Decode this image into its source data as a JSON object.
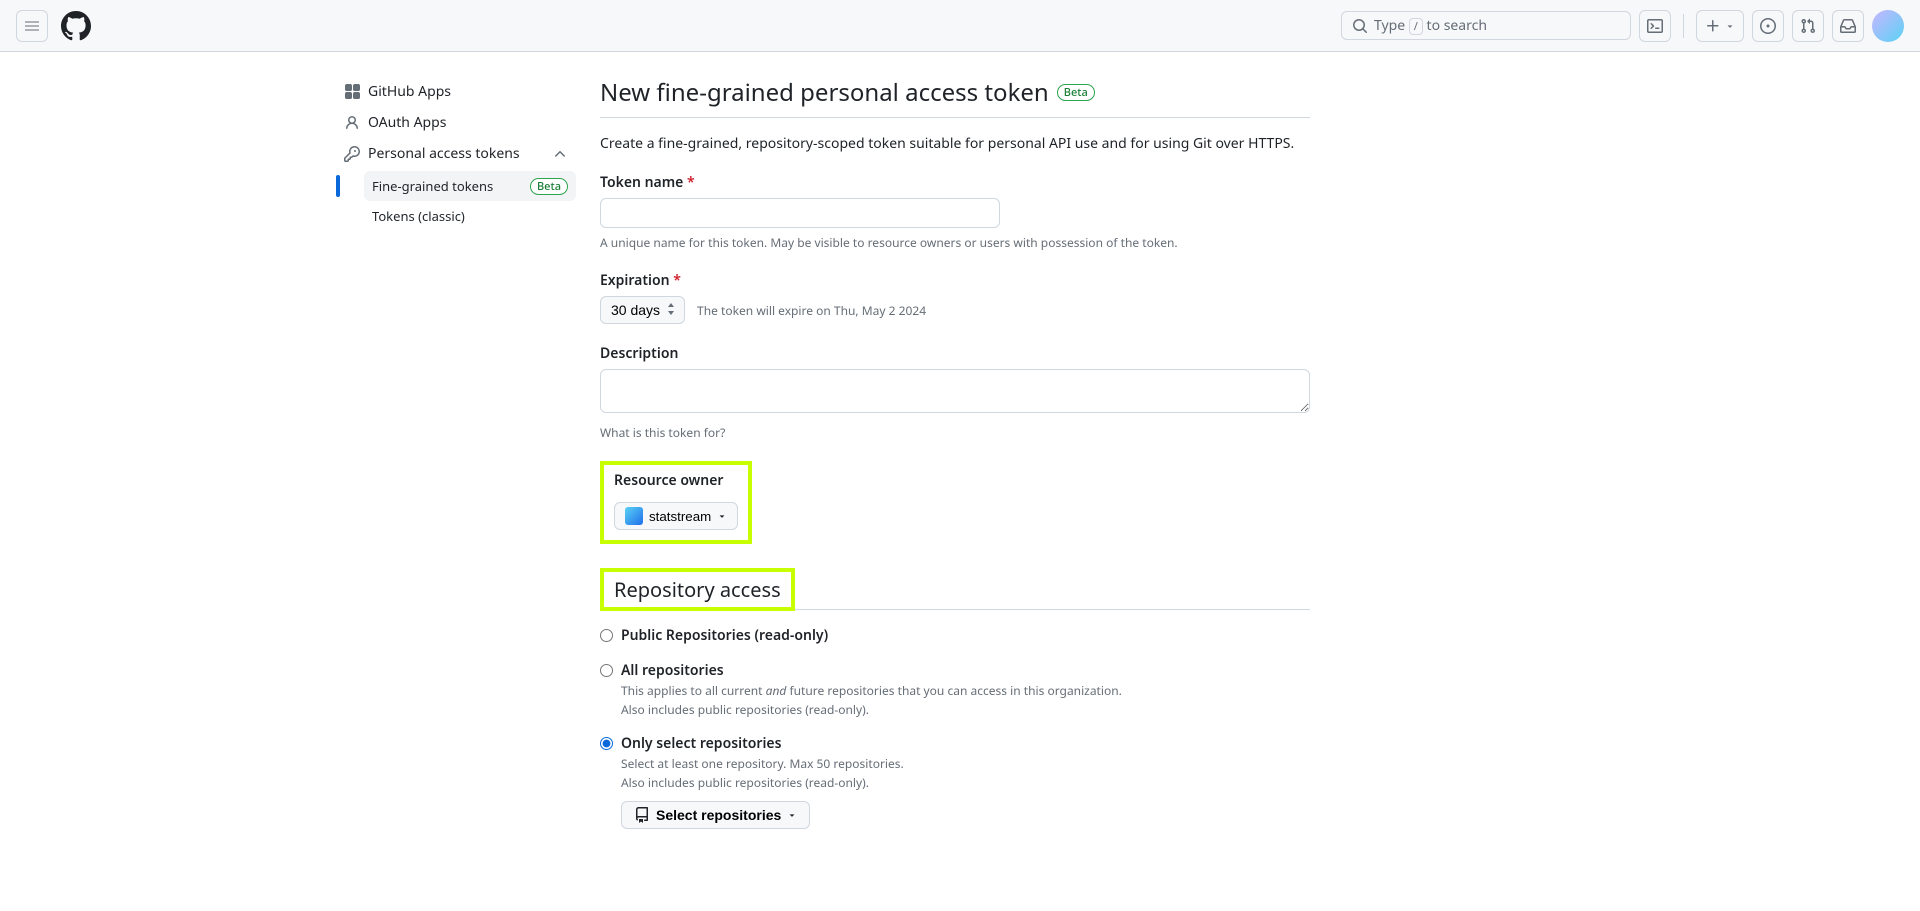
{
  "header": {
    "search_placeholder_prefix": "Type ",
    "search_key": "/",
    "search_placeholder_suffix": " to search"
  },
  "sidebar": {
    "items": [
      {
        "label": "GitHub Apps"
      },
      {
        "label": "OAuth Apps"
      },
      {
        "label": "Personal access tokens"
      }
    ],
    "subitems": [
      {
        "label": "Fine-grained tokens",
        "badge": "Beta"
      },
      {
        "label": "Tokens (classic)"
      }
    ]
  },
  "page": {
    "title": "New fine-grained personal access token",
    "title_badge": "Beta",
    "intro": "Create a fine-grained, repository-scoped token suitable for personal API use and for using Git over HTTPS."
  },
  "form": {
    "token_name": {
      "label": "Token name",
      "help": "A unique name for this token. May be visible to resource owners or users with possession of the token."
    },
    "expiration": {
      "label": "Expiration",
      "value": "30 days",
      "note": "The token will expire on Thu, May 2 2024"
    },
    "description": {
      "label": "Description",
      "help": "What is this token for?"
    },
    "resource_owner": {
      "label": "Resource owner",
      "value": "statstream"
    }
  },
  "repo_access": {
    "heading": "Repository access",
    "options": [
      {
        "label": "Public Repositories (read-only)"
      },
      {
        "label": "All repositories",
        "desc_pre": "This applies to all current ",
        "desc_em": "and",
        "desc_post": " future repositories that you can access in this organization.",
        "desc2": "Also includes public repositories (read-only)."
      },
      {
        "label": "Only select repositories",
        "desc": "Select at least one repository. Max 50 repositories.",
        "desc2": "Also includes public repositories (read-only)."
      }
    ],
    "select_btn": "Select repositories"
  }
}
